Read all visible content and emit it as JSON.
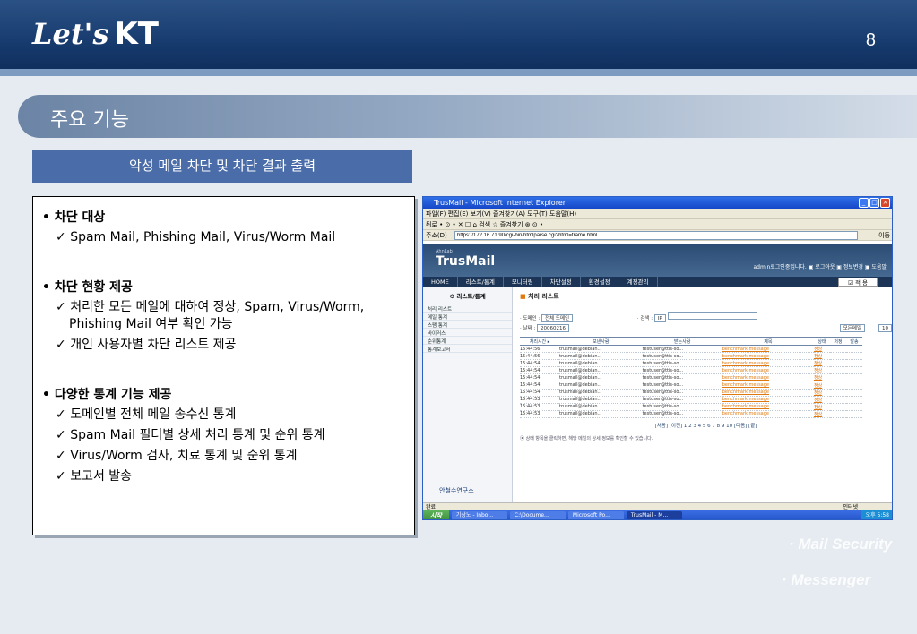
{
  "header": {
    "logo_script": "Let's",
    "logo_brand": "KT",
    "page_number": "8"
  },
  "section_title": "주요 기능",
  "subtitle": "악성 메일 차단 및 차단 결과 출력",
  "features": [
    {
      "title": "차단 대상",
      "items": [
        "Spam Mail, Phishing Mail, Virus/Worm Mail"
      ]
    },
    {
      "title": "차단 현황 제공",
      "items": [
        "처리한 모든 메일에 대하여 정상, Spam, Virus/Worm, Phishing Mail 여부 확인 가능",
        "개인 사용자별 차단 리스트 제공"
      ]
    },
    {
      "title": "다양한 통계 기능 제공",
      "items": [
        "도메인별 전체 메일 송수신 통계",
        "Spam Mail 필터별 상세 처리 통계 및 순위 통계",
        "Virus/Worm 검사, 치료 통계 및 순위 통계",
        "보고서 발송"
      ]
    }
  ],
  "watermarks": [
    "· Mail Security",
    "· Messenger"
  ],
  "browser": {
    "title": "TrusMail - Microsoft Internet Explorer",
    "menu": "파일(F)  편집(E)  보기(V)  즐겨찾기(A)  도구(T)  도움말(H)",
    "toolbar": "뒤로 • ⊙ • ✕ ☐ ⌂  검색  ☆ 즐겨찾기  ⊛  ⊙ •",
    "address_label": "주소(D)",
    "address": "https://172.16.71.90/cgi-bin/htmlparse.cgi?html=frame.html",
    "go": "이동",
    "status": "완료",
    "status_right": "인터넷"
  },
  "app": {
    "lab": "AhnLab",
    "name": "TrusMail",
    "user": "admin로그인중입니다.  ▣ 로그아웃  ▣ 정보변경  ▣ 도움말",
    "nav": [
      "HOME",
      "리스트/통계",
      "모니터링",
      "차단설정",
      "환경설정",
      "계정관리"
    ],
    "nav_select": "☑ 적 용",
    "sidebar_title": "⚙ 리스트/통계",
    "sidebar_items": [
      "처리 리스트",
      "메일 통계",
      "스팸 통계",
      "바이러스",
      "순위통계",
      "통계보고서"
    ],
    "company": "안철수연구소",
    "page_heading": "처리 리스트",
    "domain_label": "· 도메인 :",
    "domain_value": "전체 도메인",
    "search_label": "· 검색 :",
    "search_value": "IP",
    "date_label": "· 날짜 :",
    "date_value": "20060216",
    "mail_filter": "모든메일",
    "page_size": "10",
    "columns": [
      "처리시간 ▸",
      "보낸사람",
      "받는사람",
      "제목",
      "상태",
      "처정",
      "발송"
    ],
    "rows": [
      [
        "15:44:56",
        "trusmail@debian...",
        "testuser@ttis-so...",
        "benchmark message",
        "정상"
      ],
      [
        "15:44:56",
        "trusmail@debian...",
        "testuser@ttis-so...",
        "benchmark message",
        "정상"
      ],
      [
        "15:44:54",
        "trusmail@debian...",
        "testuser@ttis-so...",
        "benchmark message",
        "정상"
      ],
      [
        "15:44:54",
        "trusmail@debian...",
        "testuser@ttis-so...",
        "benchmark message",
        "정상"
      ],
      [
        "15:44:54",
        "trusmail@debian...",
        "testuser@ttis-so...",
        "benchmark message",
        "정상"
      ],
      [
        "15:44:54",
        "trusmail@debian...",
        "testuser@ttis-so...",
        "benchmark message",
        "정상"
      ],
      [
        "15:44:54",
        "trusmail@debian...",
        "testuser@ttis-so...",
        "benchmark message",
        "정상"
      ],
      [
        "15:44:53",
        "trusmail@debian...",
        "testuser@ttis-so...",
        "benchmark message",
        "정상"
      ],
      [
        "15:44:53",
        "trusmail@debian...",
        "testuser@ttis-so...",
        "benchmark message",
        "정상"
      ],
      [
        "15:44:53",
        "trusmail@debian...",
        "testuser@ttis-so...",
        "benchmark message",
        "정상"
      ]
    ],
    "pager": "[처음] [이전]  1 2 3 4 5 6 7 8 9 10  [다음] [끝]",
    "note": "⦿ 상태 항목을 클릭하면, 해당 메일의 상세 정보를 확인할 수 있습니다."
  },
  "taskbar": {
    "start": "시작",
    "tasks": [
      "기상노 - Inbo...",
      "C:\\Docume...",
      "Microsoft Po...",
      "TrusMail - M..."
    ],
    "clock": "오후 5:58"
  }
}
